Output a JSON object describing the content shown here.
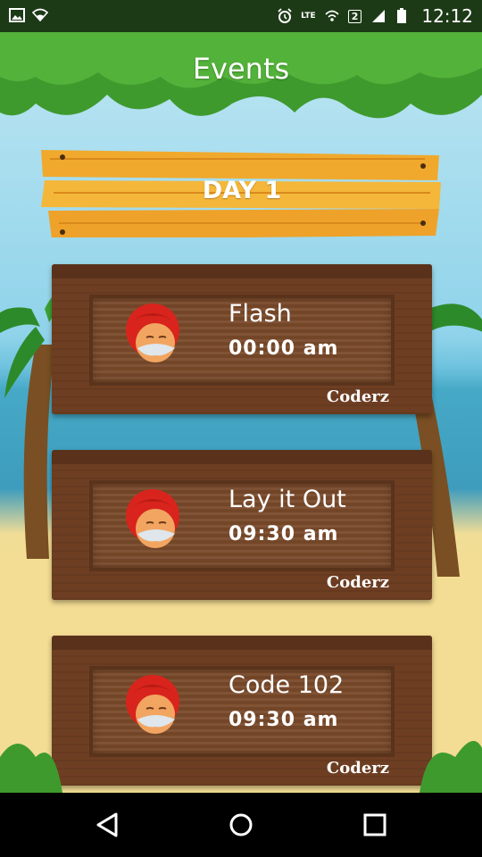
{
  "status_bar": {
    "time": "12:12",
    "network_label": "LTE",
    "sim_badge": "2",
    "icons": [
      "image-icon",
      "wifi-icon",
      "alarm-icon",
      "volte-icon",
      "wifi-call-icon",
      "signal-icon",
      "battery-icon"
    ]
  },
  "header": {
    "title": "Events"
  },
  "day": {
    "label": "DAY 1"
  },
  "events": [
    {
      "name": "Flash",
      "time": "00:00 am",
      "organizer": "Coderz"
    },
    {
      "name": "Lay it Out",
      "time": "09:30 am",
      "organizer": "Coderz"
    },
    {
      "name": "Code 102",
      "time": "09:30 am",
      "organizer": "Coderz"
    }
  ],
  "nav": {
    "back": "back-icon",
    "home": "home-icon",
    "recents": "recents-icon"
  },
  "colors": {
    "status_bar": "#1d3a17",
    "wood_dark": "#6e3e22",
    "board_yellow": "#f2b233"
  }
}
